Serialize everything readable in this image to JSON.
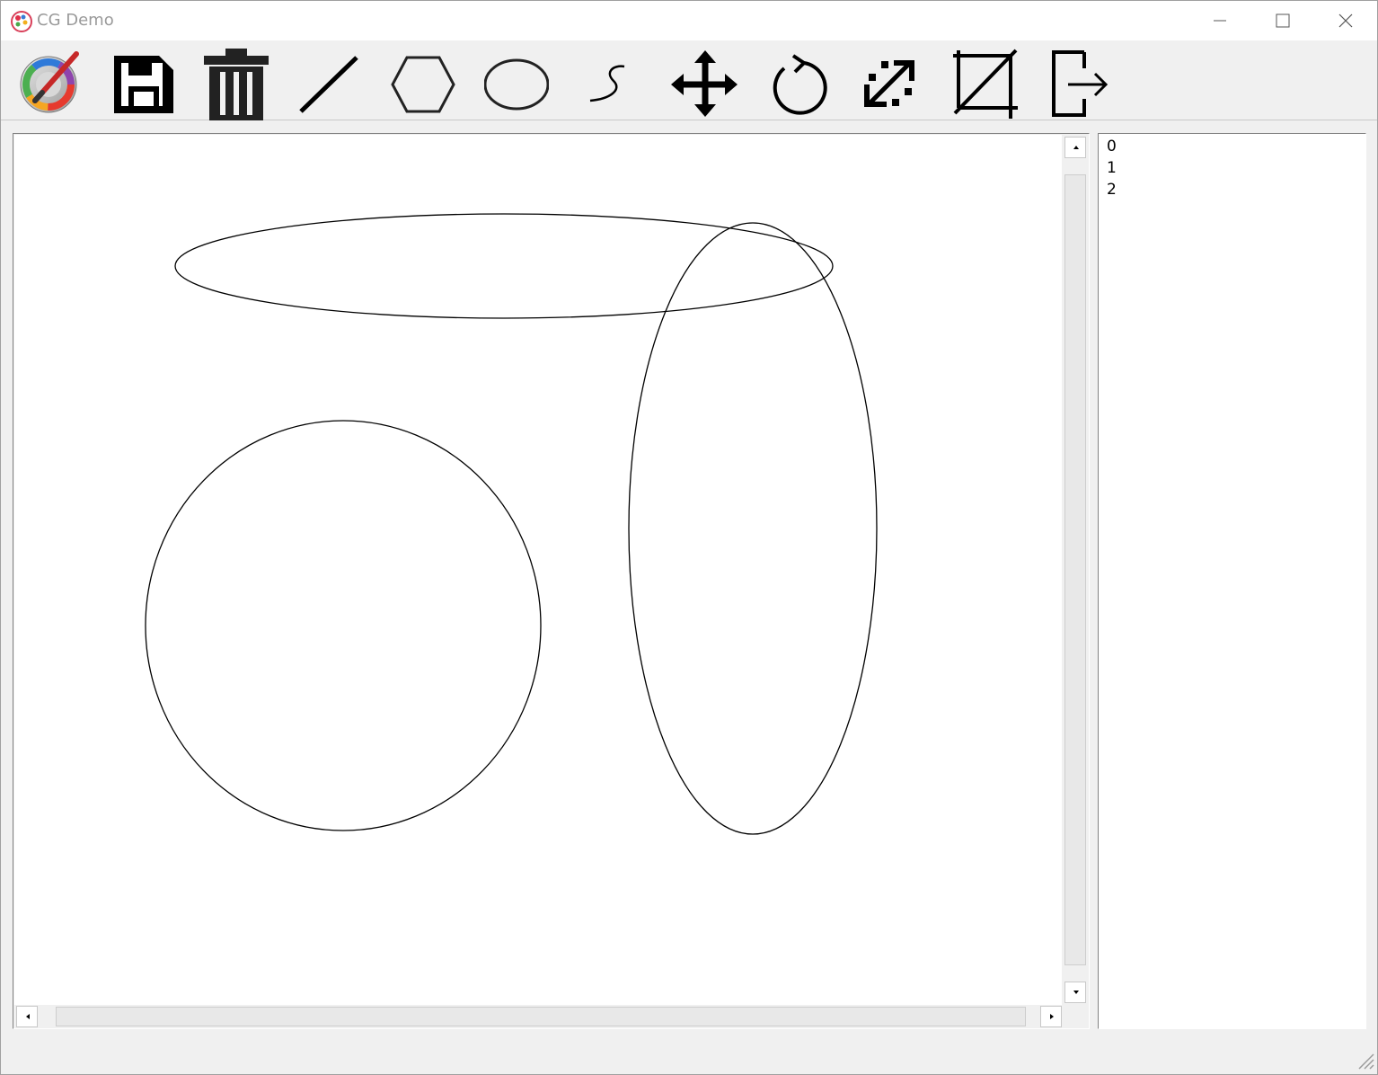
{
  "window": {
    "title": "CG Demo"
  },
  "toolbar": {
    "tools": [
      {
        "name": "palette-icon"
      },
      {
        "name": "save-icon"
      },
      {
        "name": "trash-icon"
      },
      {
        "name": "line-icon"
      },
      {
        "name": "polygon-icon"
      },
      {
        "name": "ellipse-icon"
      },
      {
        "name": "curve-icon"
      },
      {
        "name": "move-icon"
      },
      {
        "name": "rotate-icon"
      },
      {
        "name": "scale-icon"
      },
      {
        "name": "clip-icon"
      },
      {
        "name": "exit-icon"
      }
    ]
  },
  "primitives_list": {
    "items": [
      "0",
      "1",
      "2"
    ]
  },
  "colors": {
    "stroke": "#000000",
    "background": "#f0f0f0",
    "canvas": "#ffffff"
  }
}
